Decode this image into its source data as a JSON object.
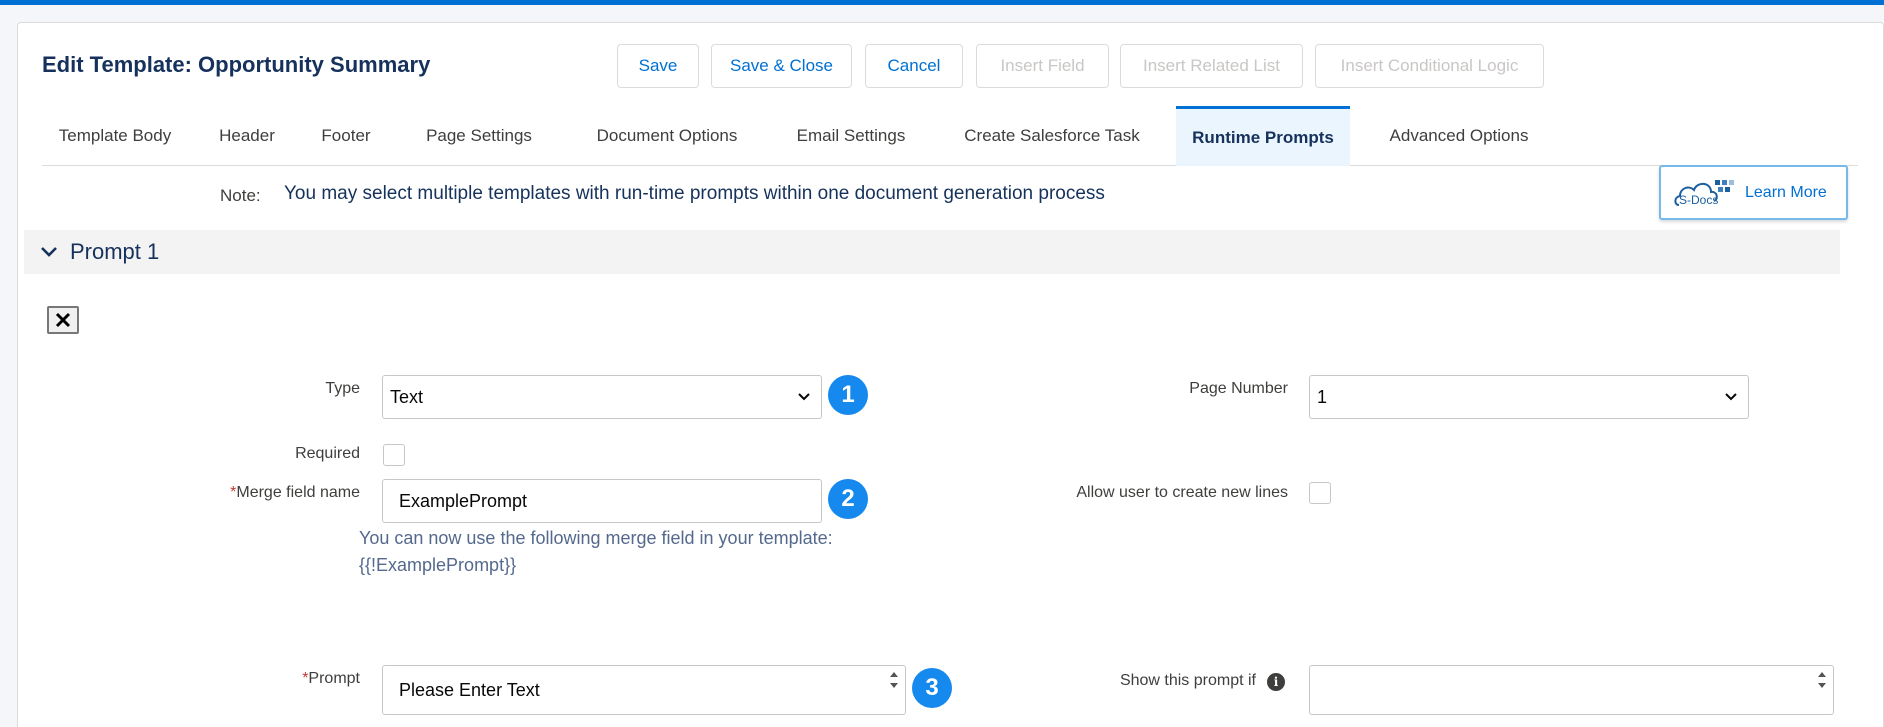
{
  "title": "Edit Template: Opportunity Summary",
  "toolbar": {
    "save": "Save",
    "save_close": "Save & Close",
    "cancel": "Cancel",
    "insert_field": "Insert Field",
    "insert_related_list": "Insert Related List",
    "insert_conditional_logic": "Insert Conditional Logic"
  },
  "tabs": [
    {
      "label": "Template Body"
    },
    {
      "label": "Header"
    },
    {
      "label": "Footer"
    },
    {
      "label": "Page Settings"
    },
    {
      "label": "Document Options"
    },
    {
      "label": "Email Settings"
    },
    {
      "label": "Create Salesforce Task"
    },
    {
      "label": "Runtime Prompts",
      "active": true
    },
    {
      "label": "Advanced Options"
    }
  ],
  "note": {
    "label": "Note:",
    "text": "You may select multiple templates with run-time prompts within one document generation process"
  },
  "learn_more": {
    "logo_text": "S-Docs",
    "label": "Learn More"
  },
  "prompt": {
    "title": "Prompt 1",
    "type_label": "Type",
    "type_value": "Text",
    "page_number_label": "Page Number",
    "page_number_value": "1",
    "required_label": "Required",
    "required_checked": false,
    "required_star": "*",
    "merge_field_label": "Merge field name",
    "merge_field_value": "ExamplePrompt",
    "allow_new_lines_label": "Allow user to create new lines",
    "allow_new_lines_checked": false,
    "helper_text": "You can now use the following merge field in your template: {{!ExamplePrompt}}",
    "prompt_label": "Prompt",
    "prompt_value": "Please Enter Text",
    "show_if_label": "Show this prompt if",
    "show_if_value": ""
  },
  "badges": [
    "1",
    "2",
    "3"
  ],
  "colors": {
    "accent": "#0070d2",
    "badge": "#1589ee",
    "title": "#16325c",
    "required": "#c23934"
  },
  "icons": {
    "collapse": "chevron-down-icon",
    "close": "close-icon",
    "select": "chevron-down-icon",
    "info": "info-icon",
    "logo": "s-docs-cloud-icon"
  }
}
